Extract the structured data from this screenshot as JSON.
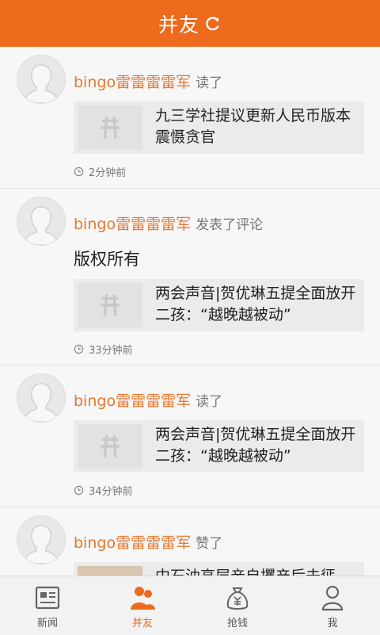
{
  "header": {
    "title": "并友"
  },
  "colors": {
    "brand": "#ee6a1d",
    "username": "#e8772e"
  },
  "feed": [
    {
      "user": "bingo雷雷雷雷军",
      "action": "读了",
      "comment": "",
      "article": "九三学社提议更新人民币版本 震慑贪官",
      "time": "2分钟前"
    },
    {
      "user": "bingo雷雷雷雷军",
      "action": "发表了评论",
      "comment": "版权所有",
      "article": "两会声音|贺优琳五提全面放开二孩：“越晚越被动”",
      "time": "33分钟前"
    },
    {
      "user": "bingo雷雷雷雷军",
      "action": "读了",
      "comment": "",
      "article": "两会声音|贺优琳五提全面放开二孩：“越晚越被动”",
      "time": "34分钟前"
    },
    {
      "user": "bingo雷雷雷雷军",
      "action": "赞了",
      "comment": "",
      "article": "中石油高层亲自攫产后未惩",
      "time": ""
    }
  ],
  "tabs": [
    {
      "label": "新闻",
      "icon": "news-icon"
    },
    {
      "label": "并友",
      "icon": "friends-icon",
      "active": true
    },
    {
      "label": "抢钱",
      "icon": "money-bag-icon"
    },
    {
      "label": "我",
      "icon": "person-icon"
    }
  ]
}
